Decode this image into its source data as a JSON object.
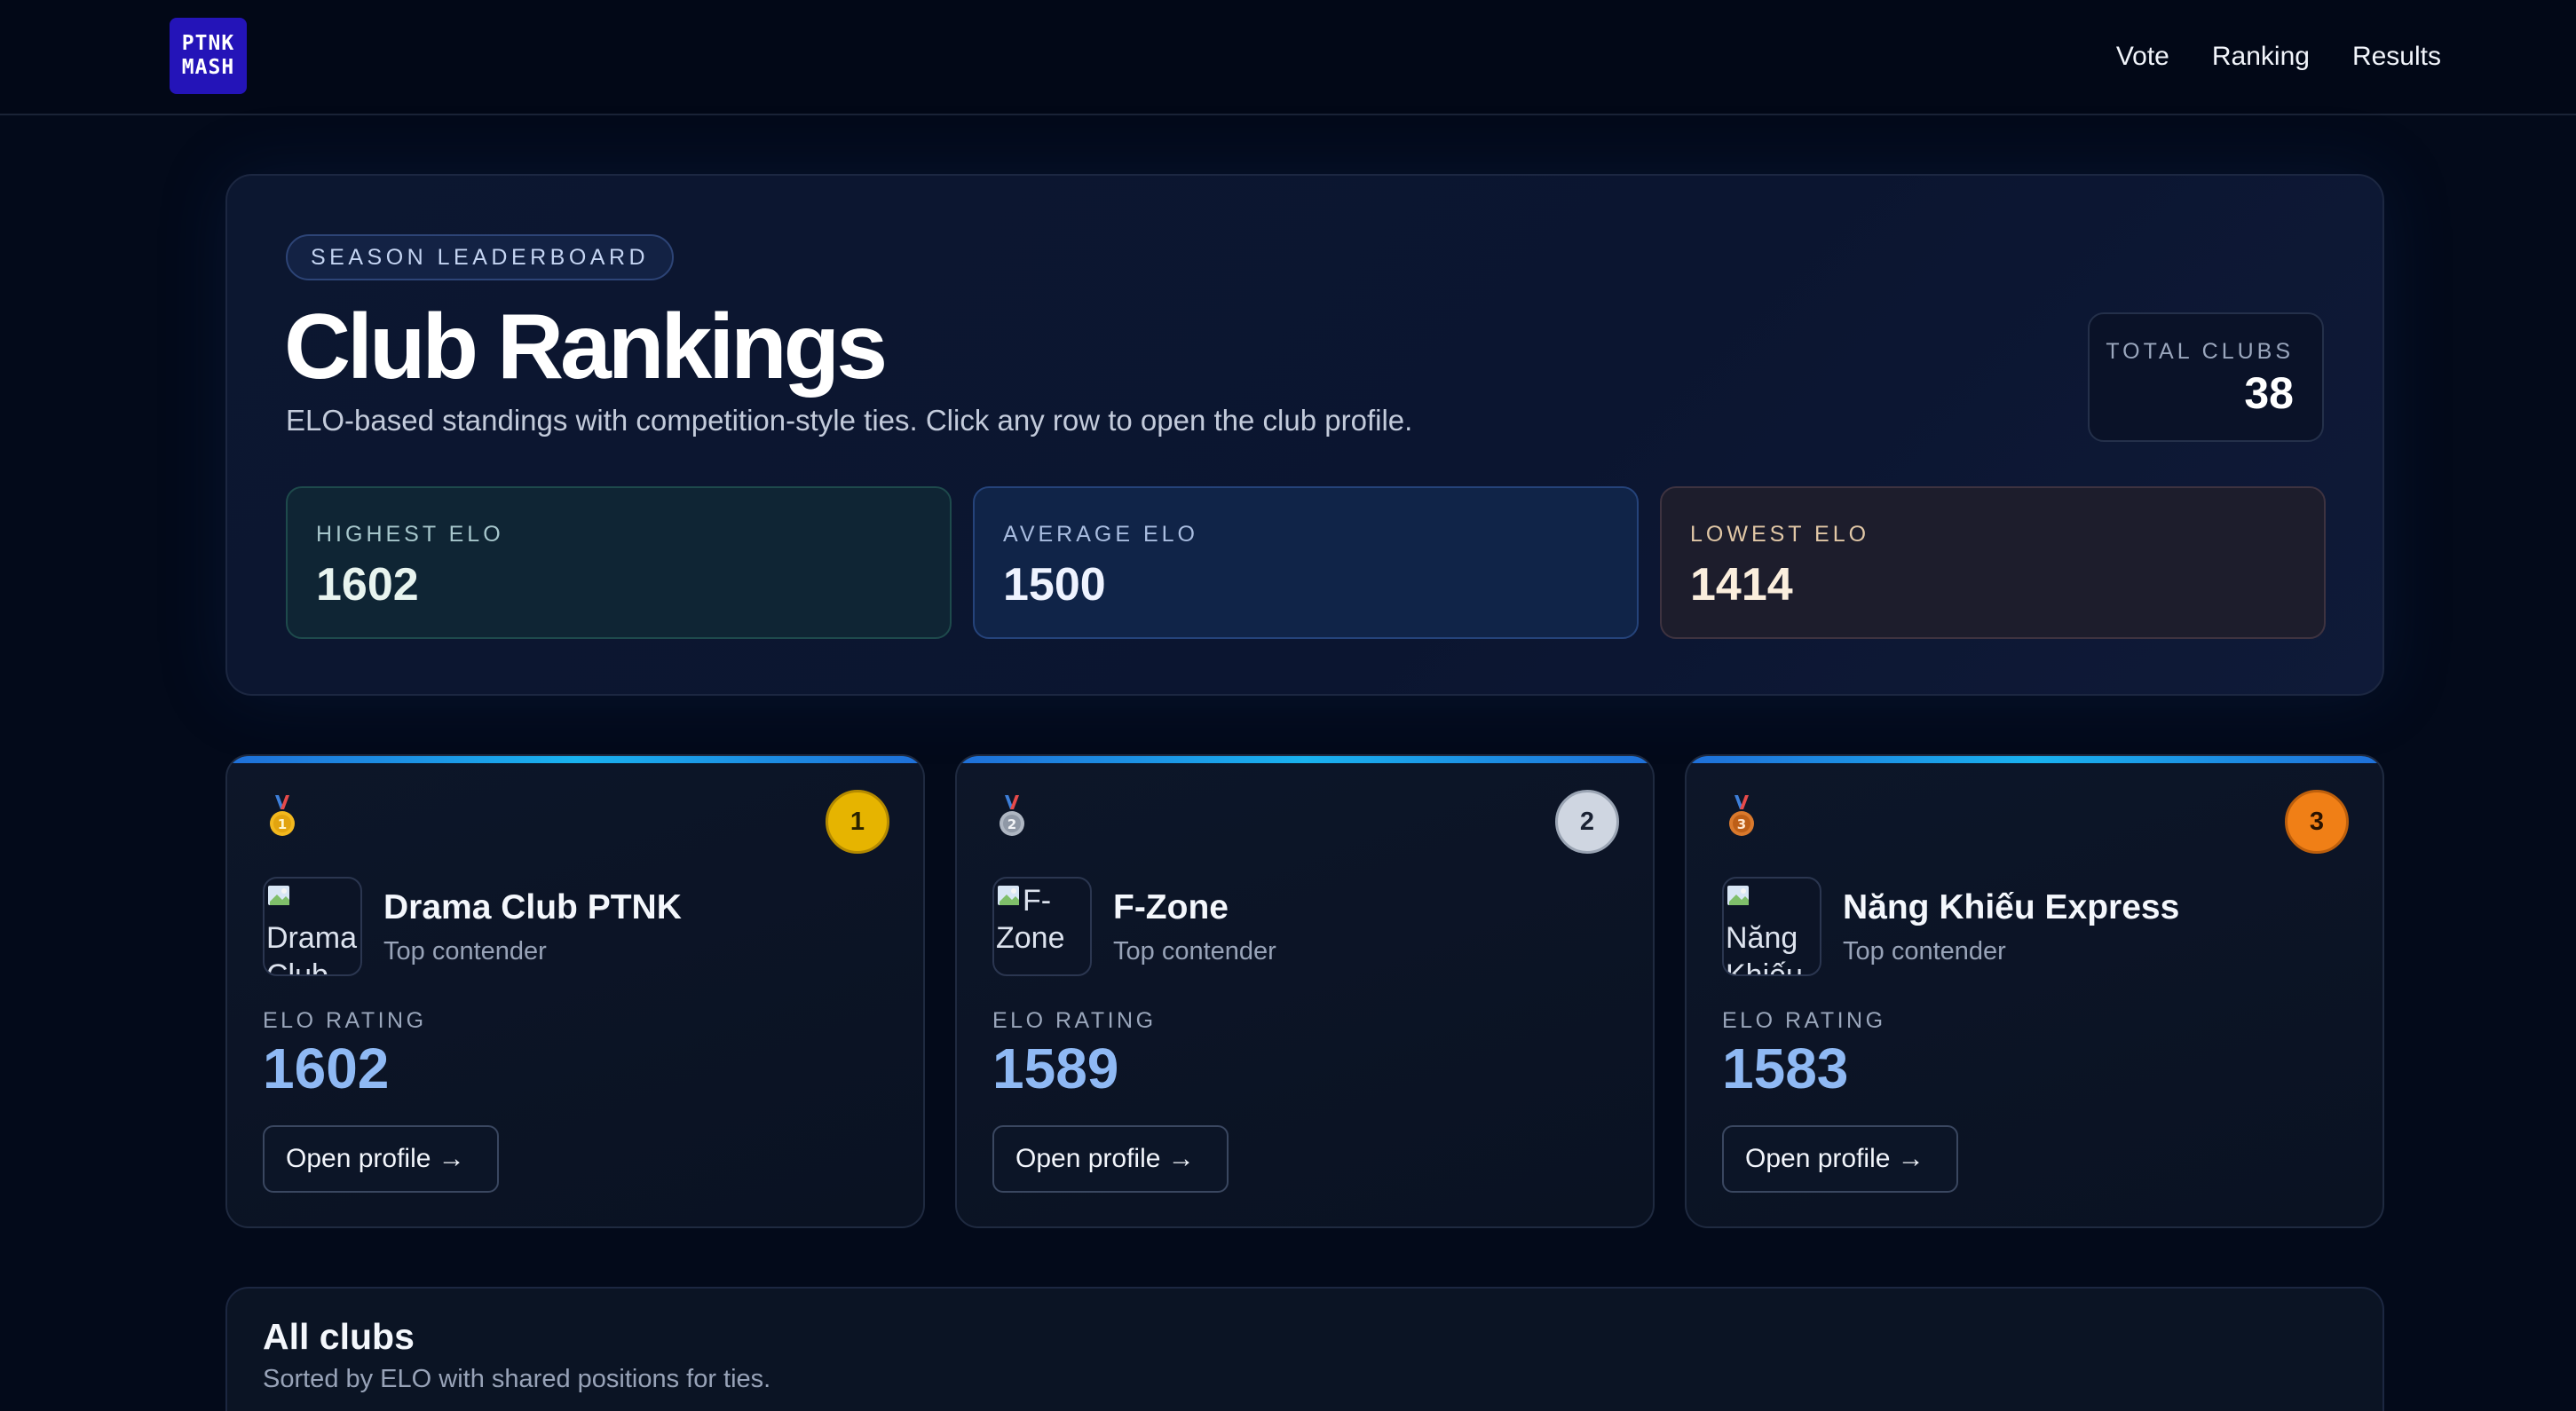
{
  "logo": {
    "line1": "PTNK",
    "line2": "MASH"
  },
  "nav": {
    "vote": "Vote",
    "ranking": "Ranking",
    "results": "Results"
  },
  "hero": {
    "pill": "SEASON LEADERBOARD",
    "title": "Club Rankings",
    "subtitle": "ELO-based standings with competition-style ties. Click any row to open the club profile.",
    "total_label": "TOTAL CLUBS",
    "total_value": "38",
    "stats": {
      "highest": {
        "label": "HIGHEST ELO",
        "value": "1602"
      },
      "average": {
        "label": "AVERAGE ELO",
        "value": "1500"
      },
      "lowest": {
        "label": "LOWEST ELO",
        "value": "1414"
      }
    }
  },
  "podium": [
    {
      "rank": "1",
      "medal": "gold-medal-icon",
      "avatar_alt": "Drama Club",
      "name": "Drama Club PTNK",
      "tag": "Top contender",
      "elo_label": "ELO RATING",
      "elo": "1602",
      "button": "Open profile",
      "badge_color": "#e6b400"
    },
    {
      "rank": "2",
      "medal": "silver-medal-icon",
      "avatar_alt": "F-Zone",
      "name": "F-Zone",
      "tag": "Top contender",
      "elo_label": "ELO RATING",
      "elo": "1589",
      "button": "Open profile",
      "badge_color": "#cfd6e1"
    },
    {
      "rank": "3",
      "medal": "bronze-medal-icon",
      "avatar_alt": "Năng Khiếu",
      "name": "Năng Khiếu Express",
      "tag": "Top contender",
      "elo_label": "ELO RATING",
      "elo": "1583",
      "button": "Open profile",
      "badge_color": "#f07f16"
    }
  ],
  "all_clubs": {
    "title": "All clubs",
    "subtitle": "Sorted by ELO with shared positions for ties."
  }
}
